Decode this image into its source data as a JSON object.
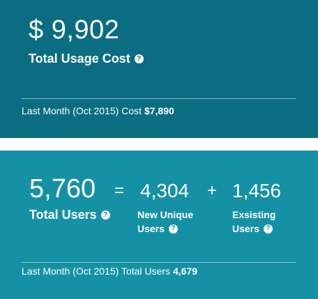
{
  "cost_card": {
    "amount": "$ 9,902",
    "label": "Total Usage Cost",
    "footer_text": "Last Month (Oct 2015) Cost",
    "footer_value": "$7,890",
    "bg_color": "#0b6d82"
  },
  "users_card": {
    "total": "5,760",
    "label": "Total Users",
    "equals": "=",
    "plus": "+",
    "new_unique": {
      "value": "4,304",
      "label_line1": "New Unique",
      "label_line2": "Users"
    },
    "existing": {
      "value": "1,456",
      "label_line1": "Exsisting",
      "label_line2": "Users"
    },
    "footer_text": "Last Month (Oct 2015) Total Users",
    "footer_value": "4,679",
    "bg_color": "#1591a5"
  },
  "icons": {
    "help": "question-circle-icon",
    "help_glyph": "?"
  }
}
